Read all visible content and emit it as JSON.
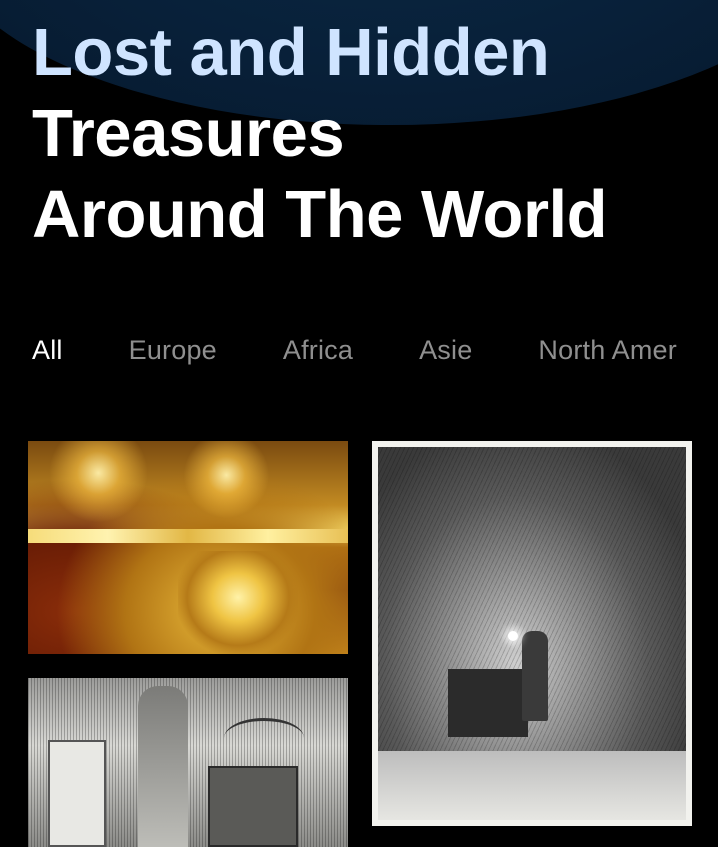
{
  "header": {
    "title_line1": "Lost and Hidden",
    "title_line2": "Treasures",
    "title_line3": "Around The World"
  },
  "filters": {
    "tabs": [
      {
        "label": "All",
        "active": true
      },
      {
        "label": "Europe",
        "active": false
      },
      {
        "label": "Africa",
        "active": false
      },
      {
        "label": "Asie",
        "active": false
      },
      {
        "label": "North Amer",
        "active": false
      }
    ]
  },
  "gallery": {
    "items": [
      {
        "icon": "amber-room-image"
      },
      {
        "icon": "ark-vault-engraving-image"
      },
      {
        "icon": "temple-priest-engraving-image"
      }
    ]
  },
  "colors": {
    "background": "#000000",
    "title_highlight": "#cfe4ff",
    "tab_active": "#ffffff",
    "tab_inactive": "#8f8f8f",
    "header_arc": "#082039"
  }
}
